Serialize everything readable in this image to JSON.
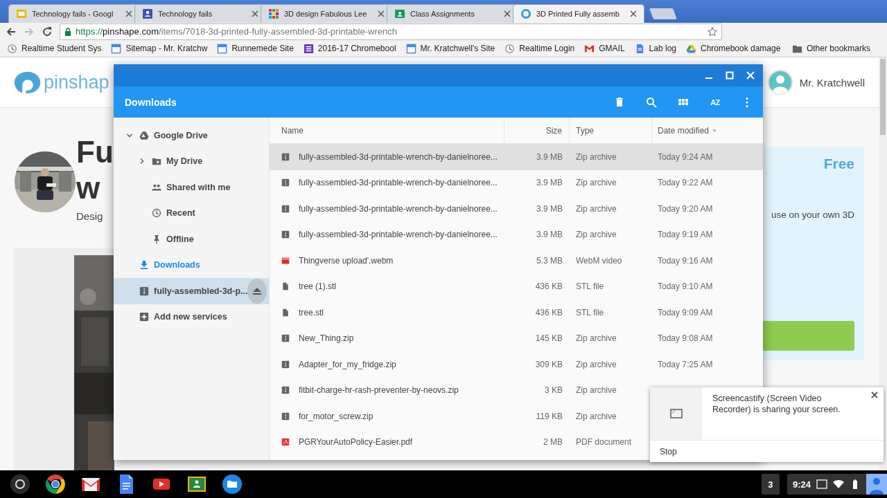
{
  "browser": {
    "tabs": [
      {
        "title": "Technology fails - Googl",
        "kind": "slides",
        "selected": false
      },
      {
        "title": "Technology fails",
        "kind": "forms",
        "selected": false
      },
      {
        "title": "3D design Fabulous Lee",
        "kind": "grid",
        "selected": false
      },
      {
        "title": "Class Assignments",
        "kind": "sheets",
        "selected": false
      },
      {
        "title": "3D Printed Fully assemb",
        "kind": "ring",
        "selected": true
      }
    ],
    "address_bar": {
      "scheme": "https://",
      "host": "pinshape.com",
      "path": "/items/7018-3d-printed-fully-assembled-3d-printable-wrench"
    },
    "bookmarks": [
      {
        "label": "Realtime Student Sys",
        "kind": "clock"
      },
      {
        "label": "Sitemap - Mr. Kratchw",
        "kind": "page"
      },
      {
        "label": "Runnemede Site",
        "kind": "page"
      },
      {
        "label": "2016-17 Chromebool",
        "kind": "list"
      },
      {
        "label": "Mr. Kratchwell's Site",
        "kind": "page"
      },
      {
        "label": "Realtime Login",
        "kind": "clock"
      },
      {
        "label": "GMAIL",
        "kind": "mail"
      },
      {
        "label": "Lab log",
        "kind": "doc"
      },
      {
        "label": "Chromebook damage",
        "kind": "drive"
      }
    ],
    "other_bookmarks": "Other bookmarks"
  },
  "page": {
    "logo_text": "pinshap",
    "user_name": "Mr. Kratchwell",
    "title_lines": [
      "Fu",
      "w"
    ],
    "byline": "Desig",
    "offer_title": "Free",
    "offer_text": "use on your own 3D"
  },
  "files_app": {
    "title": "Downloads",
    "sort_label": "AZ",
    "sidebar": [
      {
        "label": "Google Drive",
        "kind": "drive",
        "selected": false,
        "highlighted": false,
        "expanded": true,
        "children": [
          {
            "label": "My Drive",
            "kind": "folder",
            "selected": false,
            "highlighted": false,
            "expanded": false
          },
          {
            "label": "Shared with me",
            "kind": "people",
            "selected": false,
            "highlighted": false
          },
          {
            "label": "Recent",
            "kind": "clock",
            "selected": false,
            "highlighted": false
          },
          {
            "label": "Offline",
            "kind": "pin",
            "selected": false,
            "highlighted": false
          }
        ]
      },
      {
        "label": "Downloads",
        "kind": "download",
        "selected": true,
        "highlighted": false
      },
      {
        "label": "fully-assembled-3d-p...",
        "kind": "archive",
        "selected": false,
        "highlighted": true
      },
      {
        "label": "Add new services",
        "kind": "add",
        "selected": false,
        "highlighted": false
      }
    ],
    "columns": [
      {
        "label": "Name",
        "sorted": false
      },
      {
        "label": "Size",
        "sorted": false
      },
      {
        "label": "Type",
        "sorted": false
      },
      {
        "label": "Date modified",
        "sorted": true
      }
    ],
    "rows": [
      {
        "name": "fully-assembled-3d-printable-wrench-by-danielnoree...",
        "kind": "zip",
        "size": "3.9 MB",
        "type": "Zip archive",
        "date": "Today 9:24 AM",
        "selected": true
      },
      {
        "name": "fully-assembled-3d-printable-wrench-by-danielnoree...",
        "kind": "zip",
        "size": "3.9 MB",
        "type": "Zip archive",
        "date": "Today 9:22 AM",
        "selected": false
      },
      {
        "name": "fully-assembled-3d-printable-wrench-by-danielnoree...",
        "kind": "zip",
        "size": "3.9 MB",
        "type": "Zip archive",
        "date": "Today 9:20 AM",
        "selected": false
      },
      {
        "name": "fully-assembled-3d-printable-wrench-by-danielnoree...",
        "kind": "zip",
        "size": "3.9 MB",
        "type": "Zip archive",
        "date": "Today 9:19 AM",
        "selected": false
      },
      {
        "name": "Thingverse upload'.webm",
        "kind": "video",
        "size": "5.3 MB",
        "type": "WebM video",
        "date": "Today 9:16 AM",
        "selected": false
      },
      {
        "name": "tree (1).stl",
        "kind": "file",
        "size": "436 KB",
        "type": "STL file",
        "date": "Today 9:10 AM",
        "selected": false
      },
      {
        "name": "tree.stl",
        "kind": "file",
        "size": "436 KB",
        "type": "STL file",
        "date": "Today 9:09 AM",
        "selected": false
      },
      {
        "name": "New_Thing.zip",
        "kind": "zip",
        "size": "145 KB",
        "type": "Zip archive",
        "date": "Today 9:08 AM",
        "selected": false
      },
      {
        "name": "Adapter_for_my_fridge.zip",
        "kind": "zip",
        "size": "309 KB",
        "type": "Zip archive",
        "date": "Today 7:25 AM",
        "selected": false
      },
      {
        "name": "fitbit-charge-hr-rash-preventer-by-neovs.zip",
        "kind": "zip",
        "size": "3 KB",
        "type": "Zip archive",
        "selected": false
      },
      {
        "name": "for_motor_screw.zip",
        "kind": "zip",
        "size": "119 KB",
        "type": "Zip archive",
        "selected": false
      },
      {
        "name": "PGRYourAutoPolicy-Easier.pdf",
        "kind": "pdf",
        "size": "2 MB",
        "type": "PDF document",
        "selected": false
      }
    ]
  },
  "notification": {
    "message": "Screencastify (Screen Video Recorder) is sharing your screen.",
    "action": "Stop"
  },
  "shelf": {
    "apps": [
      {
        "kind": "launcher"
      },
      {
        "kind": "browser"
      },
      {
        "kind": "mail"
      },
      {
        "kind": "doc"
      },
      {
        "kind": "play"
      },
      {
        "kind": "board"
      },
      {
        "kind": "folder"
      }
    ],
    "notification_count": "3",
    "time": "9:24"
  }
}
